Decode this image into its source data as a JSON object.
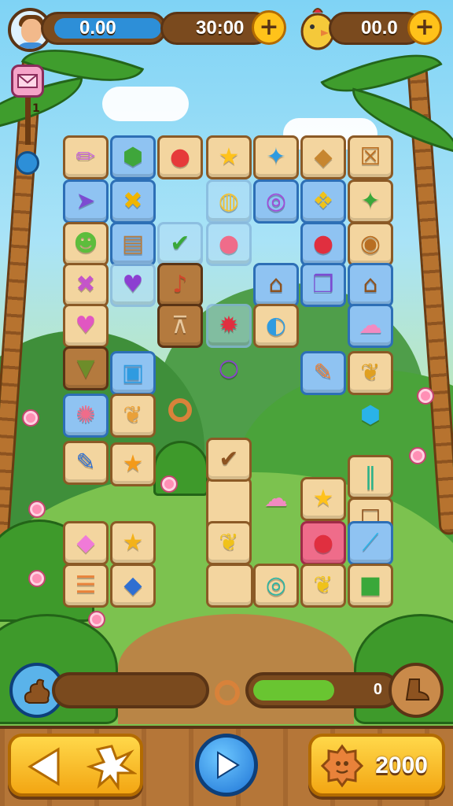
{
  "hud": {
    "money": "0.00",
    "timer": "30:00",
    "coins": "00.0",
    "side_counter": "1"
  },
  "bottom": {
    "right_progress_value": "0",
    "right_progress_fraction": 0.55,
    "score": "2000"
  },
  "colors": {
    "wood": "#7a4a1e",
    "gold": "#ffc21a",
    "blue": "#2d8fd8",
    "green": "#69c531"
  },
  "tiles": [
    {
      "icon": "crayon-icon",
      "glyph": "✏",
      "color": "#c86bd8",
      "style": "sand"
    },
    {
      "icon": "green-gem-icon",
      "glyph": "⬢",
      "color": "#3fa63b",
      "style": "blue"
    },
    {
      "icon": "red-ball-icon",
      "glyph": "●",
      "color": "#e63a3a",
      "style": "sand"
    },
    {
      "icon": "star-icon",
      "glyph": "★",
      "color": "#ffc21a",
      "style": "sand"
    },
    {
      "icon": "bird-icon",
      "glyph": "✦",
      "color": "#2f9be0",
      "style": "sand"
    },
    {
      "icon": "kite-icon",
      "glyph": "◆",
      "color": "#c7862f",
      "style": "sand"
    },
    {
      "icon": "crate-icon",
      "glyph": "☒",
      "color": "#b86e22",
      "style": "sand"
    },
    {
      "icon": "paper-plane-icon",
      "glyph": "➤",
      "color": "#7c4bd1",
      "style": "blue"
    },
    {
      "icon": "cross-icon",
      "glyph": "✖",
      "color": "#f0b500",
      "style": "blue"
    },
    {
      "icon": "melon-icon",
      "glyph": "◍",
      "color": "#f3c233",
      "style": "clear"
    },
    {
      "icon": "ring-icon",
      "glyph": "◎",
      "color": "#a24ad8",
      "style": "blue"
    },
    {
      "icon": "corn-icon",
      "glyph": "❖",
      "color": "#f0c21a",
      "style": "blue"
    },
    {
      "icon": "green-star-icon",
      "glyph": "✦",
      "color": "#3aa83a",
      "style": "sand"
    },
    {
      "icon": "green-face-icon",
      "glyph": "☻",
      "color": "#5dbd3c",
      "style": "sand"
    },
    {
      "icon": "basket-icon",
      "glyph": "▤",
      "color": "#b47a3e",
      "style": "blue"
    },
    {
      "icon": "check-icon",
      "glyph": "✔",
      "color": "#3aa83a",
      "style": "clear"
    },
    {
      "icon": "rainbow-ball-icon",
      "glyph": "●",
      "color": "#ef6c8a",
      "style": "clear"
    },
    {
      "icon": "apple-icon",
      "glyph": "●",
      "color": "#e02f3f",
      "style": "blue"
    },
    {
      "icon": "snail-icon",
      "glyph": "◉",
      "color": "#b86e22",
      "style": "sand"
    },
    {
      "icon": "cross-icon-pink",
      "glyph": "✖",
      "color": "#c455c9",
      "style": "sand"
    },
    {
      "icon": "heart-icon",
      "glyph": "♥",
      "color": "#8c3fd1",
      "style": "clear"
    },
    {
      "icon": "music-note-icon",
      "glyph": "♪",
      "color": "#d0472a",
      "style": "wood"
    },
    {
      "icon": "house-icon",
      "glyph": "⌂",
      "color": "#8d5320",
      "style": "blue"
    },
    {
      "icon": "wrapped-gift-icon",
      "glyph": "❒",
      "color": "#7c4bd1",
      "style": "blue"
    },
    {
      "icon": "hut-icon",
      "glyph": "⌂",
      "color": "#8d5320",
      "style": "blue"
    },
    {
      "icon": "pink-heart-icon",
      "glyph": "♥",
      "color": "#e156c2",
      "style": "sand"
    },
    {
      "icon": "easel-icon",
      "glyph": "⊼",
      "color": "#e7c79c",
      "style": "wood"
    },
    {
      "icon": "red-bug-icon",
      "glyph": "✹",
      "color": "#e02f3f",
      "style": "clear"
    },
    {
      "icon": "pacifier-icon",
      "glyph": "◐",
      "color": "#2f9be0",
      "style": "sand"
    },
    {
      "icon": "pink-blob-icon",
      "glyph": "☁",
      "color": "#f28ac1",
      "style": "blue"
    },
    {
      "icon": "funnel-icon",
      "glyph": "▼",
      "color": "#6d8d2a",
      "style": "wood"
    },
    {
      "icon": "blue-box-icon",
      "glyph": "▣",
      "color": "#2f9be0",
      "style": "blue"
    },
    {
      "icon": "purple-ring-icon",
      "glyph": "○",
      "color": "#8c3fd1",
      "style": "none"
    },
    {
      "icon": "pencil-icon",
      "glyph": "✎",
      "color": "#e9823a",
      "style": "blue"
    },
    {
      "icon": "rooster-icon",
      "glyph": "❦",
      "color": "#e0a020",
      "style": "sand"
    },
    {
      "icon": "beach-ball-icon",
      "glyph": "✺",
      "color": "#ef6c8a",
      "style": "blue"
    },
    {
      "icon": "duck-icon",
      "glyph": "❦",
      "color": "#e9a13a",
      "style": "sand"
    },
    {
      "icon": "blue-crystal-icon",
      "glyph": "⬢",
      "color": "#2ab3e8",
      "style": "none"
    },
    {
      "icon": "pen-icon",
      "glyph": "✎",
      "color": "#2f6fd1",
      "style": "sand"
    },
    {
      "icon": "orange-star-icon",
      "glyph": "★",
      "color": "#f39a1a",
      "style": "sand"
    },
    {
      "icon": "checkmark-tile-icon",
      "glyph": "✔",
      "color": "#8d5320",
      "style": "sand"
    },
    {
      "icon": "pipes-icon",
      "glyph": "‖",
      "color": "#2ab38a",
      "style": "sand"
    },
    {
      "icon": "blob-pink-icon",
      "glyph": "☁",
      "color": "#f28ac1",
      "style": "none"
    },
    {
      "icon": "yellow-star-icon",
      "glyph": "★",
      "color": "#ffc21a",
      "style": "sand"
    },
    {
      "icon": "wooden-frame-icon",
      "glyph": "☐",
      "color": "#8d5320",
      "style": "sand"
    },
    {
      "icon": "pink-gem-icon",
      "glyph": "◆",
      "color": "#f07ad8",
      "style": "sand"
    },
    {
      "icon": "gold-star-icon",
      "glyph": "★",
      "color": "#f3b21a",
      "style": "sand"
    },
    {
      "icon": "yellow-dog-icon",
      "glyph": "❦",
      "color": "#f0c21a",
      "style": "sand"
    },
    {
      "icon": "red-orb-icon",
      "glyph": "●",
      "color": "#e02f3f",
      "style": "pink"
    },
    {
      "icon": "syringe-icon",
      "glyph": "⟋",
      "color": "#2ab3e8",
      "style": "blue"
    },
    {
      "icon": "stack-icon",
      "glyph": "☰",
      "color": "#e9823a",
      "style": "sand"
    },
    {
      "icon": "blue-gem-icon",
      "glyph": "◆",
      "color": "#2f6fd1",
      "style": "sand"
    },
    {
      "icon": "teal-ring-icon",
      "glyph": "◎",
      "color": "#2ab3a3",
      "style": "sand"
    },
    {
      "icon": "chick-icon",
      "glyph": "❦",
      "color": "#f0c21a",
      "style": "sand"
    },
    {
      "icon": "green-square-icon",
      "glyph": "■",
      "color": "#3aa83a",
      "style": "sand"
    }
  ]
}
